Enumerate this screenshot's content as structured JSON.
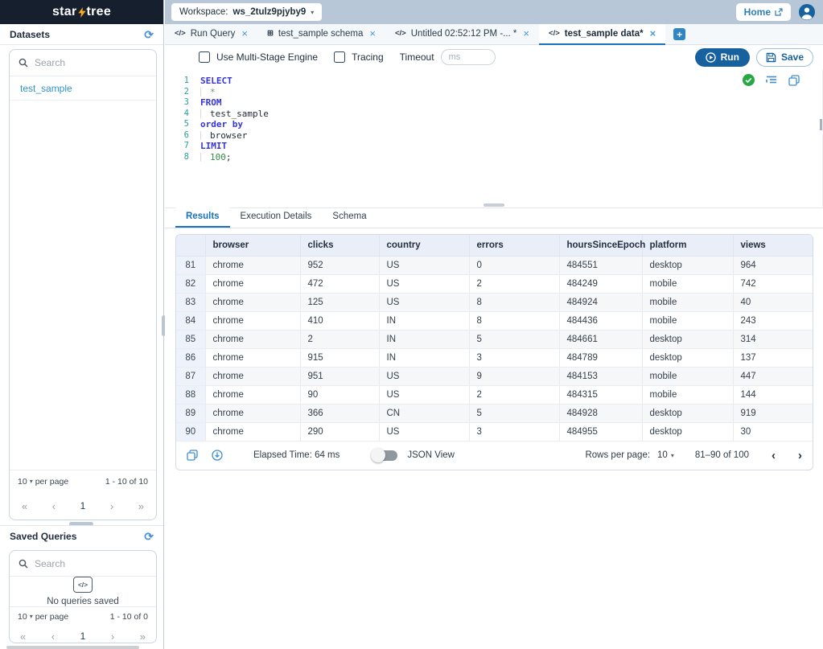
{
  "icons": {
    "code": "</>",
    "table": "⊞",
    "refresh": "⟳",
    "caret": "▾",
    "close": "×",
    "plus": "+",
    "first": "«",
    "prev": "‹",
    "next": "›",
    "last": "»"
  },
  "logo": {
    "star": "star",
    "tree": "tree"
  },
  "topbar": {
    "workspace_label": "Workspace:",
    "workspace_name": "ws_2tulz9pjyby9",
    "home": "Home"
  },
  "tabs": [
    {
      "label": "Run Query",
      "icon": "code",
      "active": false
    },
    {
      "label": "test_sample schema",
      "icon": "table",
      "active": false
    },
    {
      "label": "Untitled 02:52:12 PM -... *",
      "icon": "code",
      "active": false
    },
    {
      "label": "test_sample data*",
      "icon": "code",
      "active": true
    }
  ],
  "toolbar": {
    "multistage": "Use Multi-Stage Engine",
    "tracing": "Tracing",
    "timeout_label": "Timeout",
    "timeout_placeholder": "ms",
    "run": "Run",
    "save": "Save"
  },
  "editor": {
    "lines": [
      {
        "n": "1",
        "indent": false,
        "tokens": [
          {
            "t": "SELECT",
            "c": "kw"
          }
        ]
      },
      {
        "n": "2",
        "indent": true,
        "tokens": [
          {
            "t": "*",
            "c": "op"
          }
        ]
      },
      {
        "n": "3",
        "indent": false,
        "tokens": [
          {
            "t": "FROM",
            "c": "kw"
          }
        ]
      },
      {
        "n": "4",
        "indent": true,
        "tokens": [
          {
            "t": "test_sample",
            "c": "id"
          }
        ]
      },
      {
        "n": "5",
        "indent": false,
        "tokens": [
          {
            "t": "order by",
            "c": "kw"
          }
        ]
      },
      {
        "n": "6",
        "indent": true,
        "tokens": [
          {
            "t": "browser",
            "c": "id"
          }
        ]
      },
      {
        "n": "7",
        "indent": false,
        "tokens": [
          {
            "t": "LIMIT",
            "c": "kw"
          }
        ]
      },
      {
        "n": "8",
        "indent": true,
        "tokens": [
          {
            "t": "100",
            "c": "num"
          },
          {
            "t": ";",
            "c": "id"
          }
        ]
      }
    ]
  },
  "results": {
    "tabs": [
      "Results",
      "Execution Details",
      "Schema"
    ],
    "active_tab": "Results",
    "table": {
      "columns": [
        "browser",
        "clicks",
        "country",
        "errors",
        "hoursSinceEpoch",
        "platform",
        "views"
      ],
      "rows": [
        {
          "n": "81",
          "cells": [
            "chrome",
            "952",
            "US",
            "0",
            "484551",
            "desktop",
            "964"
          ]
        },
        {
          "n": "82",
          "cells": [
            "chrome",
            "472",
            "US",
            "2",
            "484249",
            "mobile",
            "742"
          ]
        },
        {
          "n": "83",
          "cells": [
            "chrome",
            "125",
            "US",
            "8",
            "484924",
            "mobile",
            "40"
          ]
        },
        {
          "n": "84",
          "cells": [
            "chrome",
            "410",
            "IN",
            "8",
            "484436",
            "mobile",
            "243"
          ]
        },
        {
          "n": "85",
          "cells": [
            "chrome",
            "2",
            "IN",
            "5",
            "484661",
            "desktop",
            "314"
          ]
        },
        {
          "n": "86",
          "cells": [
            "chrome",
            "915",
            "IN",
            "3",
            "484789",
            "desktop",
            "137"
          ]
        },
        {
          "n": "87",
          "cells": [
            "chrome",
            "951",
            "US",
            "9",
            "484153",
            "mobile",
            "447"
          ]
        },
        {
          "n": "88",
          "cells": [
            "chrome",
            "90",
            "US",
            "2",
            "484315",
            "mobile",
            "144"
          ]
        },
        {
          "n": "89",
          "cells": [
            "chrome",
            "366",
            "CN",
            "5",
            "484928",
            "desktop",
            "919"
          ]
        },
        {
          "n": "90",
          "cells": [
            "chrome",
            "290",
            "US",
            "3",
            "484955",
            "desktop",
            "30"
          ]
        }
      ]
    },
    "footer": {
      "elapsed": "Elapsed Time: 64 ms",
      "json_view": "JSON View",
      "rows_per_page_label": "Rows per page:",
      "rows_per_page_value": "10",
      "range": "81–90 of 100"
    }
  },
  "sidebar": {
    "datasets": {
      "title": "Datasets",
      "search_placeholder": "Search",
      "items": [
        "test_sample"
      ],
      "per_page_value": "10",
      "per_page_label": "per page",
      "range": "1 - 10 of 10",
      "page": "1"
    },
    "saved_queries": {
      "title": "Saved Queries",
      "search_placeholder": "Search",
      "empty_text": "No queries saved",
      "per_page_value": "10",
      "per_page_label": "per page",
      "range": "1 - 10 of 0",
      "page": "1"
    }
  },
  "colors": {
    "accent": "#1a72b8",
    "navy": "#151f2d",
    "topband": "#b8c7d8",
    "link": "#3093cb",
    "run_button": "#16619e",
    "success": "#27a844",
    "bolt": "#f9a825"
  }
}
